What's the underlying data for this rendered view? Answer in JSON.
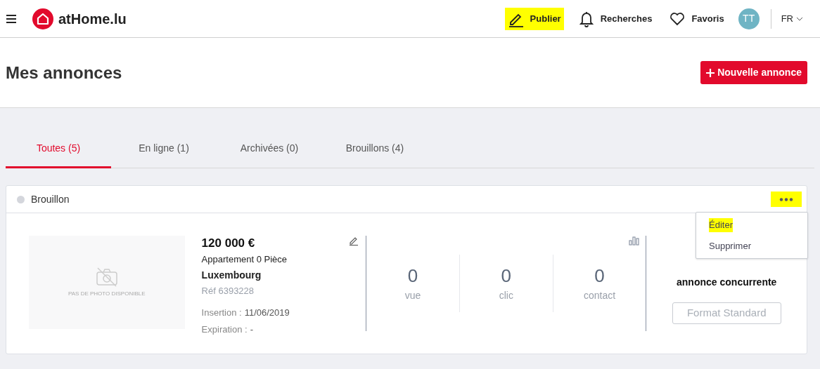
{
  "header": {
    "logo": "atHome.lu",
    "nav": [
      {
        "kind": "publish",
        "label": "Publier",
        "highlighted": true
      },
      {
        "kind": "bell",
        "label": "Recherches",
        "highlighted": false
      },
      {
        "kind": "heart",
        "label": "Favoris",
        "highlighted": false
      }
    ],
    "avatar": "TT",
    "language": "FR"
  },
  "page_title": "Mes annonces",
  "new_button": "Nouvelle annonce",
  "tabs": [
    {
      "label": "Toutes (5)",
      "selected": true
    },
    {
      "label": "En ligne (1)",
      "selected": false
    },
    {
      "label": "Archivées (0)",
      "selected": false
    },
    {
      "label": "Brouillons (4)",
      "selected": false
    }
  ],
  "listing": {
    "status": {
      "label": "Brouillon",
      "color": "#d4d6dc"
    },
    "more_highlighted": true,
    "no_photo": "PAS DE PHOTO DISPONIBLE",
    "price": "120 000 €",
    "type": "Appartement 0 Pièce",
    "city": "Luxembourg",
    "ref": "Réf 6393228",
    "insertion_label": "Insertion :",
    "insertion": "11/06/2019",
    "expiration_label": "Expiration :",
    "expiration": "-",
    "stats": [
      {
        "value": "0",
        "label": "vue"
      },
      {
        "value": "0",
        "label": "clic"
      },
      {
        "value": "0",
        "label": "contact"
      }
    ],
    "competitors_label": "annonce concurrente",
    "format_button": "Format Standard",
    "menu": [
      {
        "label": "Éditer",
        "highlighted": true
      },
      {
        "label": "Supprimer",
        "highlighted": false
      }
    ]
  }
}
